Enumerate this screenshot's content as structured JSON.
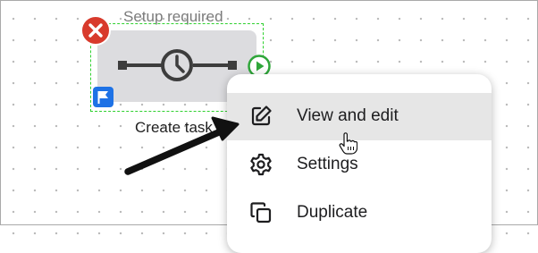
{
  "canvas": {
    "node": {
      "status_label": "Setup required",
      "name": "Create task",
      "icons": {
        "error": "close-x-icon",
        "flag": "flag-icon",
        "body": "timer-clock-icon",
        "run": "play-circle-icon"
      }
    }
  },
  "context_menu": {
    "items": [
      {
        "label": "View and edit",
        "icon": "edit-pencil-icon",
        "hovered": true
      },
      {
        "label": "Settings",
        "icon": "gear-icon",
        "hovered": false
      },
      {
        "label": "Duplicate",
        "icon": "duplicate-icon",
        "hovered": false
      }
    ]
  },
  "colors": {
    "selection_outline": "#2fd12f",
    "error": "#d83a2c",
    "flag": "#1e72e6",
    "hover_row": "#e6e6e6",
    "card": "#dcdcdf"
  }
}
